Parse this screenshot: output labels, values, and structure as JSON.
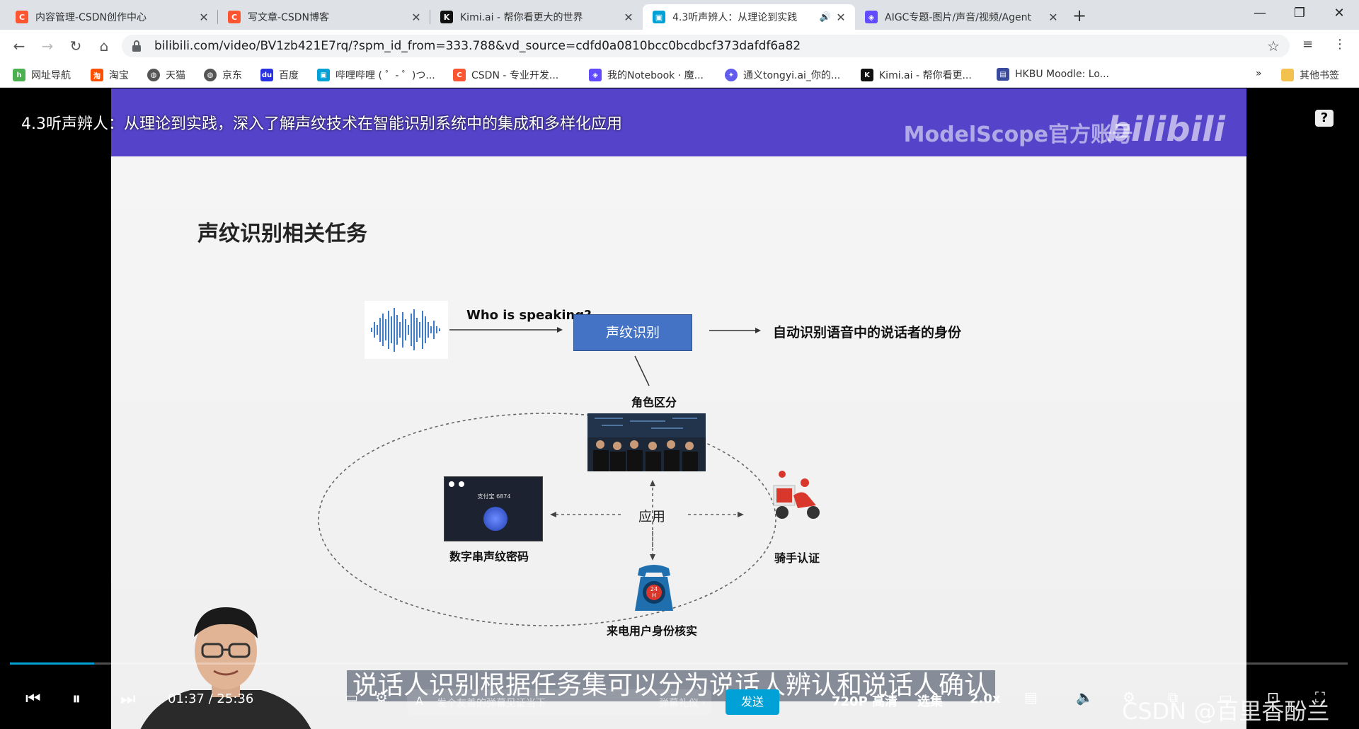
{
  "tabs": [
    {
      "title": "内容管理-CSDN创作中心",
      "icon": "csdn-icon",
      "color": "#fc5531"
    },
    {
      "title": "写文章-CSDN博客",
      "icon": "csdn-icon",
      "color": "#fc5531"
    },
    {
      "title": "Kimi.ai - 帮你看更大的世界",
      "icon": "kimi-icon",
      "color": "#111111"
    },
    {
      "title": "4.3听声辨人：从理论到实践",
      "icon": "bilibili-icon",
      "color": "#00a1d6"
    },
    {
      "title": "AIGC专题-图片/声音/视频/Agent",
      "icon": "modelscope-icon",
      "color": "#624aff"
    }
  ],
  "address": {
    "url": "bilibili.com/video/BV1zb421E7rq/?spm_id_from=333.788&vd_source=cdfd0a0810bcc0bcdbcf373dafdf6a82"
  },
  "bookmarks": [
    {
      "label": "网址导航",
      "icon": "hao123-icon",
      "color": "#4caf50"
    },
    {
      "label": "淘宝",
      "icon": "taobao-icon",
      "color": "#ff5000"
    },
    {
      "label": "天猫",
      "icon": "globe-icon",
      "color": "#555555"
    },
    {
      "label": "京东",
      "icon": "globe-icon",
      "color": "#555555"
    },
    {
      "label": "百度",
      "icon": "baidu-icon",
      "color": "#2932e1"
    },
    {
      "label": "哔哩哔哩 ( ゜- ゜)つ...",
      "icon": "bilibili-icon",
      "color": "#00a1d6"
    },
    {
      "label": "CSDN - 专业开发...",
      "icon": "csdn-icon",
      "color": "#fc5531"
    },
    {
      "label": "我的Notebook · 魔...",
      "icon": "modelscope-icon",
      "color": "#624aff"
    },
    {
      "label": "通义tongyi.ai_你的...",
      "icon": "tongyi-icon",
      "color": "#615ced"
    },
    {
      "label": "Kimi.ai - 帮你看更...",
      "icon": "kimi-icon",
      "color": "#111111"
    },
    {
      "label": "HKBU Moodle: Lo...",
      "icon": "moodle-icon",
      "color": "#3a4a9c"
    }
  ],
  "bookmarks_overflow": "»",
  "other_bookmarks": "其他书签",
  "video": {
    "title": "4.3听声辨人：从理论到实践，深入了解声纹技术在智能识别系统中的集成和多样化应用",
    "brand": "ModelScope官方账号",
    "bili_logo": "bilibili"
  },
  "slide": {
    "title": "声纹识别相关任务",
    "who": "Who is speaking?",
    "box": "声纹识别",
    "auto": "自动识别语音中的说话者的身份",
    "role": "角色区分",
    "app": "应用",
    "digit": "数字串声纹密码",
    "rider": "骑手认证",
    "caller": "来电用户身份核实",
    "screen_text": "支付宝 6874",
    "hotline_text": "24H"
  },
  "subtitle": "说话人识别根据任务集可以分为说话人辨认和说话人确认",
  "player": {
    "time_current": "01:37",
    "time_sep": "/",
    "time_total": "25:36",
    "progress": 0.063,
    "danmu_placeholder": "发个友善的弹幕见证当下",
    "danmu_etiquette": "弹幕礼仪 ›",
    "send": "发送",
    "quality": "720P 高清",
    "episodes": "选集",
    "speed": "2.0x"
  },
  "watermark": "CSDN @百里香酚兰"
}
